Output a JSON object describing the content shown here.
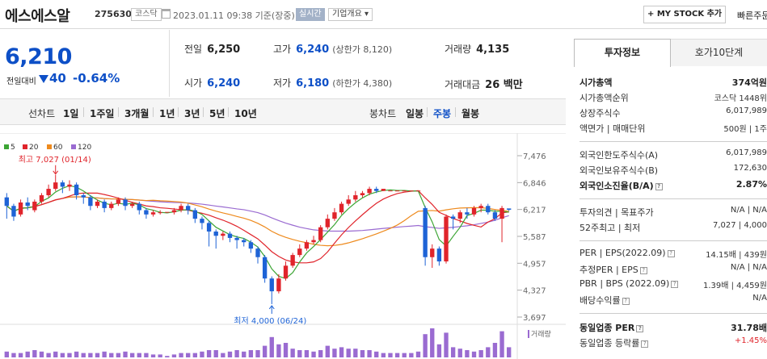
{
  "header": {
    "name": "에스에스알",
    "code": "275630",
    "market": "코스닥",
    "datetime": "2023.01.11 09:38 기준(장중)",
    "realtime": "실시간",
    "overview": "기업개요 ▾",
    "mystock": "+ MY STOCK 추가",
    "quick": "빠른주문"
  },
  "price": {
    "current": "6,210",
    "change_label": "전일대비",
    "change": "40",
    "change_pct": "-0.64%"
  },
  "stats": {
    "prev_close": {
      "label": "전일",
      "value": "6,250"
    },
    "high": {
      "label": "고가",
      "value": "6,240",
      "sub": "(상한가 8,120)"
    },
    "volume": {
      "label": "거래량",
      "value": "4,135"
    },
    "open": {
      "label": "시가",
      "value": "6,240"
    },
    "low": {
      "label": "저가",
      "value": "6,180",
      "sub": "(하한가 4,380)"
    },
    "amount": {
      "label": "거래대금",
      "value": "26 백만"
    }
  },
  "tabs": {
    "line": "선차트",
    "d1": "1일",
    "w1": "1주일",
    "m3": "3개월",
    "y1": "1년",
    "y3": "3년",
    "y5": "5년",
    "y10": "10년",
    "candle": "봉차트",
    "daily": "일봉",
    "weekly": "주봉",
    "monthly": "월봉"
  },
  "colors": {
    "up": "#e0242b",
    "down": "#1e63d6",
    "ma5": "#3ca534",
    "ma20": "#e0242b",
    "ma60": "#ee8a1d",
    "ma120": "#9a6bd1"
  },
  "chart_data": {
    "type": "candlestick",
    "legend": [
      "5",
      "20",
      "60",
      "120"
    ],
    "y_ticks": [
      "7,476",
      "6,846",
      "6,217",
      "5,587",
      "4,957",
      "4,327",
      "3,697"
    ],
    "ylim": [
      3697,
      7476
    ],
    "high_note": "최고 7,027 (01/14)",
    "low_note": "최저 4,000 (06/24)",
    "volume_label": "거래량",
    "candles": [
      [
        6500,
        6300,
        6600,
        6000
      ],
      [
        6300,
        6050,
        6350,
        5950
      ],
      [
        6100,
        6380,
        6450,
        6050
      ],
      [
        6380,
        6300,
        6500,
        6200
      ],
      [
        6200,
        6400,
        6450,
        6150
      ],
      [
        6400,
        6550,
        6600,
        6350
      ],
      [
        6550,
        6700,
        6800,
        6500
      ],
      [
        6700,
        6850,
        7027,
        6650
      ],
      [
        6850,
        6750,
        6900,
        6600
      ],
      [
        6750,
        6800,
        6900,
        6650
      ],
      [
        6800,
        6550,
        6850,
        6450
      ],
      [
        6550,
        6500,
        6600,
        6350
      ],
      [
        6500,
        6300,
        6550,
        6200
      ],
      [
        6300,
        6400,
        6450,
        6250
      ],
      [
        6400,
        6250,
        6450,
        6150
      ],
      [
        6250,
        6350,
        6400,
        6200
      ],
      [
        6350,
        6450,
        6500,
        6300
      ],
      [
        6450,
        6300,
        6500,
        6200
      ],
      [
        6300,
        6350,
        6400,
        6250
      ],
      [
        6350,
        6200,
        6400,
        6100
      ],
      [
        6200,
        6100,
        6250,
        6000
      ],
      [
        6100,
        6150,
        6200,
        6050
      ],
      [
        6150,
        6150,
        6200,
        6100
      ],
      [
        6150,
        6150,
        6150,
        6150
      ],
      [
        6150,
        6200,
        6250,
        6100
      ],
      [
        6200,
        6300,
        6350,
        6150
      ],
      [
        6300,
        6200,
        6350,
        6100
      ],
      [
        6200,
        6000,
        6250,
        5900
      ],
      [
        6000,
        5900,
        6050,
        5750
      ],
      [
        5900,
        5700,
        5950,
        5350
      ],
      [
        5700,
        5600,
        5750,
        5300
      ],
      [
        5600,
        5650,
        5700,
        5500
      ],
      [
        5650,
        5550,
        5700,
        5450
      ],
      [
        5550,
        5500,
        5600,
        5300
      ],
      [
        5500,
        5450,
        5550,
        5350
      ],
      [
        5450,
        5300,
        5500,
        5200
      ],
      [
        5300,
        5100,
        5350,
        4950
      ],
      [
        5100,
        4600,
        5150,
        4500
      ],
      [
        4600,
        4300,
        4650,
        4000
      ],
      [
        4300,
        4600,
        4700,
        4250
      ],
      [
        4600,
        4900,
        5000,
        4550
      ],
      [
        4900,
        5150,
        5200,
        4850
      ],
      [
        5150,
        5300,
        5400,
        5100
      ],
      [
        5300,
        5450,
        5500,
        5250
      ],
      [
        5450,
        5500,
        5600,
        5400
      ],
      [
        5500,
        5800,
        5850,
        5450
      ],
      [
        5800,
        6000,
        6100,
        5750
      ],
      [
        6000,
        6150,
        6250,
        5950
      ],
      [
        6150,
        6350,
        6400,
        6100
      ],
      [
        6350,
        6450,
        6550,
        6300
      ],
      [
        6450,
        6550,
        6650,
        6400
      ],
      [
        6550,
        6600,
        6650,
        6500
      ],
      [
        6600,
        6700,
        6750,
        6550
      ],
      [
        6700,
        6650,
        6750,
        6600
      ],
      [
        6650,
        6700,
        6700,
        6650
      ],
      [
        6650,
        6650,
        6650,
        6650
      ],
      [
        6650,
        6650,
        6650,
        6650
      ],
      [
        6650,
        6650,
        6650,
        6650
      ],
      [
        6650,
        6650,
        6650,
        6650
      ],
      [
        6650,
        6650,
        6650,
        6650
      ],
      [
        6250,
        5100,
        6300,
        4900
      ],
      [
        5100,
        5300,
        5400,
        4850
      ],
      [
        5300,
        5000,
        5350,
        4900
      ],
      [
        5000,
        6050,
        6100,
        4950
      ],
      [
        6050,
        6000,
        6100,
        5750
      ],
      [
        6000,
        6150,
        6200,
        5900
      ],
      [
        6150,
        6100,
        6250,
        6000
      ],
      [
        6100,
        6250,
        6300,
        6050
      ],
      [
        6250,
        6300,
        6350,
        6150
      ],
      [
        6300,
        6150,
        6350,
        6100
      ],
      [
        6150,
        6000,
        6200,
        5950
      ],
      [
        6000,
        6250,
        6300,
        5450
      ],
      [
        6240,
        6210,
        6240,
        6180
      ]
    ],
    "volume": [
      4,
      3,
      3,
      4,
      5,
      4,
      3,
      4,
      3,
      3,
      4,
      3,
      3,
      3,
      4,
      3,
      3,
      4,
      3,
      3,
      3,
      2,
      2,
      1,
      2,
      3,
      3,
      3,
      4,
      5,
      5,
      3,
      4,
      5,
      4,
      5,
      5,
      8,
      14,
      9,
      10,
      6,
      5,
      5,
      4,
      5,
      8,
      6,
      7,
      6,
      6,
      5,
      5,
      4,
      3,
      3,
      3,
      3,
      3,
      4,
      16,
      20,
      9,
      17,
      7,
      6,
      5,
      4,
      5,
      7,
      10,
      18,
      7
    ]
  },
  "panel": {
    "tab_invest": "투자정보",
    "tab_hoga": "호가10단계",
    "market_cap": {
      "label": "시가총액",
      "value": "374억원"
    },
    "market_cap_rank": {
      "label": "시가총액순위",
      "value": "코스닥 1448위"
    },
    "listed_shares": {
      "label": "상장주식수",
      "value": "6,017,989"
    },
    "face_value": {
      "label": "액면가 | 매매단위",
      "value": "500원 | 1주"
    },
    "foreign_limit": {
      "label": "외국인한도주식수(A)",
      "value": "6,017,989"
    },
    "foreign_hold": {
      "label": "외국인보유주식수(B)",
      "value": "172,630"
    },
    "foreign_ratio": {
      "label": "외국인소진율(B/A)",
      "value": "2.87%"
    },
    "opinion": {
      "label": "투자의견 | 목표주가",
      "value": "N/A | N/A"
    },
    "week52": {
      "label": "52주최고 | 최저",
      "value": "7,027 | 4,000"
    },
    "per": {
      "label": "PER | EPS(2022.09)",
      "value": "14.15배 | 439원"
    },
    "est_per": {
      "label": "추정PER | EPS",
      "value": "N/A | N/A"
    },
    "pbr": {
      "label": "PBR | BPS (2022.09)",
      "value": "1.39배 | 4,459원"
    },
    "dividend": {
      "label": "배당수익률",
      "value": "N/A"
    },
    "sector_per": {
      "label": "동일업종 PER",
      "value": "31.78배"
    },
    "sector_rate": {
      "label": "동일업종 등락률",
      "value": "+1.45%"
    }
  }
}
